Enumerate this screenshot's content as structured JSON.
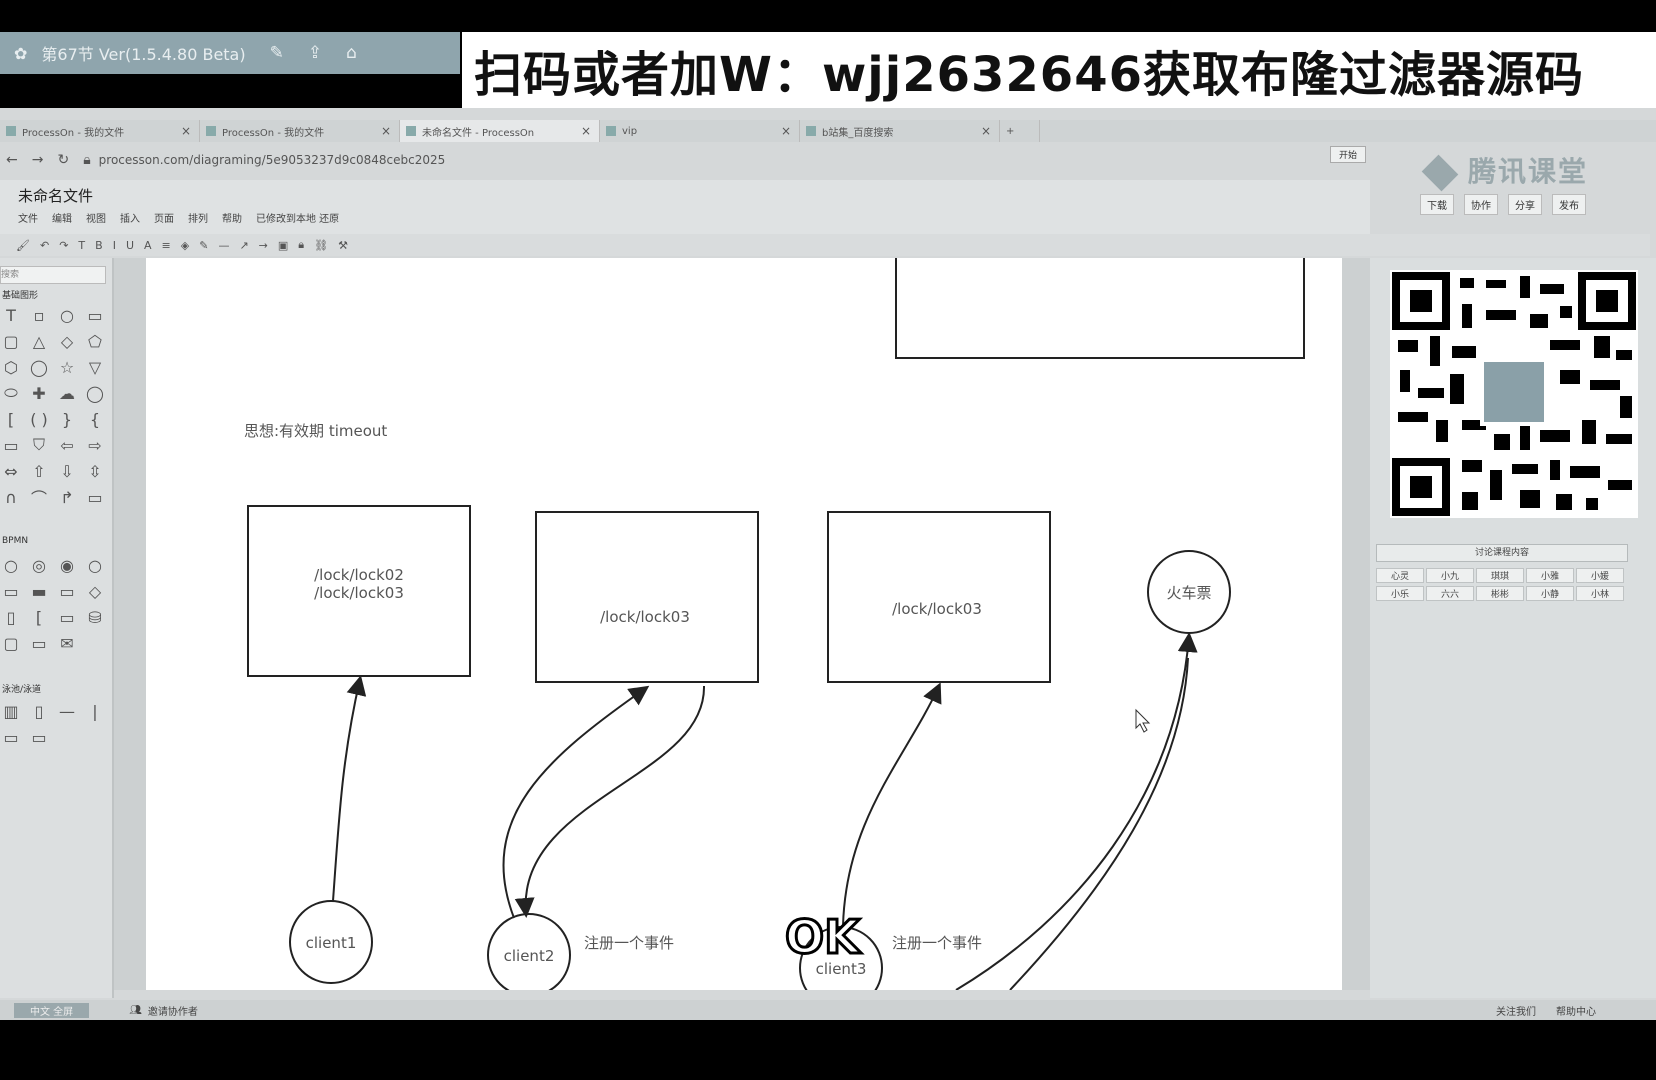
{
  "player": {
    "lesson_label": "第67节 Ver(1.5.4.80 Beta)"
  },
  "promo": {
    "text": "扫码或者加W：wjj2632646获取布隆过滤器源码"
  },
  "tabs": [
    {
      "label": "ProcessOn - 我的文件"
    },
    {
      "label": "ProcessOn - 我的文件"
    },
    {
      "label": "未命名文件 - ProcessOn"
    },
    {
      "label": "vip"
    },
    {
      "label": "b站集_百度搜索"
    }
  ],
  "address": {
    "url": "processon.com/diagraming/5e9053237d9c0848cebc2025"
  },
  "app": {
    "file_title": "未命名文件",
    "menu": [
      "文件",
      "编辑",
      "视图",
      "插入",
      "页面",
      "排列",
      "帮助",
      "已修改到本地 还原"
    ],
    "brand": "腾讯课堂",
    "actions": [
      "下载",
      "协作",
      "分享",
      "发布"
    ],
    "open_button": "开始"
  },
  "shape_panel": {
    "search_placeholder": "搜索",
    "categories": [
      "基础图形",
      "BPMN",
      "泳池/泳道"
    ]
  },
  "diagram": {
    "note": "思想:有效期  timeout",
    "boxes": [
      {
        "lines": [
          "/lock/lock02",
          "/lock/lock03"
        ]
      },
      {
        "lines": [
          "/lock/lock03"
        ]
      },
      {
        "lines": [
          "/lock/lock03"
        ]
      }
    ],
    "train_label": "火车票",
    "clients": [
      "client1",
      "client2",
      "client3"
    ],
    "event_labels": [
      "注册一个事件",
      "注册一个事件"
    ]
  },
  "teach_panel": {
    "title": "讨论课程内容",
    "items": [
      "心灵",
      "小九",
      "琪琪",
      "小雅",
      "小媛",
      "小乐",
      "六六",
      "彬彬",
      "小静",
      "小林"
    ]
  },
  "status": {
    "left": "中文 全屏",
    "collab": "邀请协作者",
    "follow": "关注我们",
    "help": "帮助中心"
  },
  "caption": {
    "text": "OK"
  }
}
